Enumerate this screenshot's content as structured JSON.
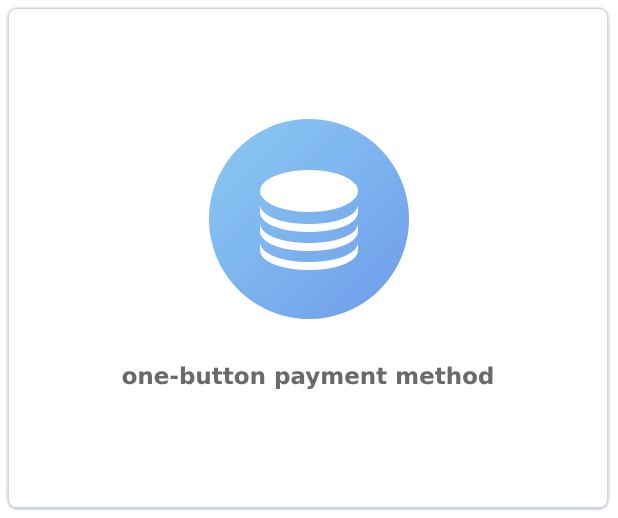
{
  "card": {
    "icon": "database-coins-icon",
    "caption": "one-button payment method"
  },
  "colors": {
    "icon_gradient_start": "#8cc8f4",
    "icon_gradient_end": "#6f9bea",
    "icon_glyph": "#ffffff",
    "caption_text": "#6a6a6a",
    "card_border": "#cfd6de"
  }
}
